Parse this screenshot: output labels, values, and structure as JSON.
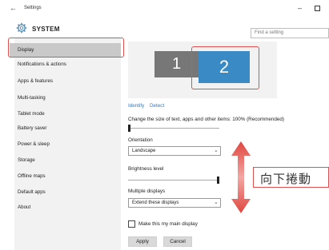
{
  "titlebar": {
    "back_glyph": "←",
    "title": "Settings",
    "minimize_glyph": "–"
  },
  "header": {
    "title": "SYSTEM",
    "search_placeholder": "Find a setting"
  },
  "sidebar": {
    "items": [
      {
        "label": "Display"
      },
      {
        "label": "Notifications & actions"
      },
      {
        "label": "Apps & features"
      },
      {
        "label": "Multi-tasking"
      },
      {
        "label": "Tablet mode"
      },
      {
        "label": "Battery saver"
      },
      {
        "label": "Power & sleep"
      },
      {
        "label": "Storage"
      },
      {
        "label": "Offline maps"
      },
      {
        "label": "Default apps"
      },
      {
        "label": "About"
      }
    ]
  },
  "display": {
    "monitor_1": "1",
    "monitor_2": "2",
    "identify_link": "Identify",
    "detect_link": "Detect",
    "scale_label": "Change the size of text, apps and other items: 100% (Recommended)",
    "scale_level": 0,
    "orientation_label": "Orientation",
    "orientation_value": "Landscape",
    "brightness_label": "Brightness level",
    "brightness_level": 1.0,
    "multiple_displays_label": "Multiple displays",
    "multiple_displays_value": "Extend these displays",
    "main_display_label": "Make this my main display",
    "main_display_checked": false,
    "apply_label": "Apply",
    "cancel_label": "Cancel"
  },
  "annotation": {
    "scroll_text": "向下捲動"
  },
  "colors": {
    "accent": "#3a8bc5",
    "highlight": "#e05050",
    "monitor_inactive": "#777777"
  },
  "icons": {
    "back": "back-arrow-icon",
    "gear": "gear-icon",
    "chevron": "chevron-down-icon"
  }
}
